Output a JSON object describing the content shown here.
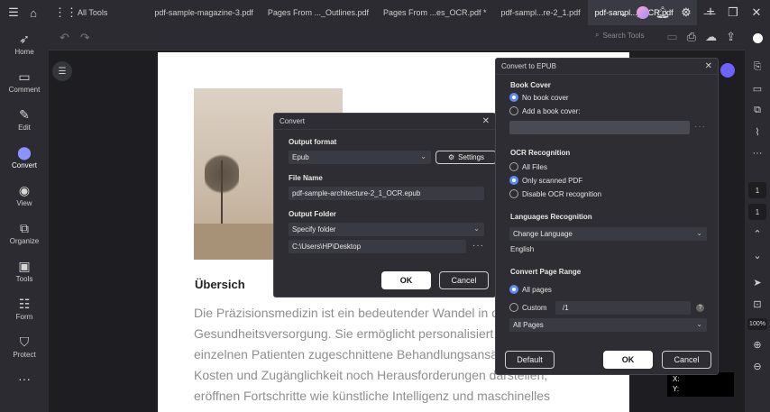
{
  "titlebar": {
    "all_tools": "All Tools",
    "tabs": [
      {
        "label": "pdf-sample-magazine-3.pdf"
      },
      {
        "label": "Pages  From ..._Outlines.pdf"
      },
      {
        "label": "Pages  From ...es_OCR.pdf *"
      },
      {
        "label": "pdf-sampl...re-2_1.pdf"
      },
      {
        "label": "pdf-sampl..._OCR.pdf"
      }
    ]
  },
  "sidebar": {
    "items": [
      {
        "label": "Home",
        "icon": "rocket-icon"
      },
      {
        "label": "Comment",
        "icon": "comment-icon"
      },
      {
        "label": "Edit",
        "icon": "edit-icon"
      },
      {
        "label": "Convert",
        "icon": "convert-icon"
      },
      {
        "label": "View",
        "icon": "eye-icon"
      },
      {
        "label": "Organize",
        "icon": "organize-icon"
      },
      {
        "label": "Tools",
        "icon": "toolbox-icon"
      },
      {
        "label": "Form",
        "icon": "form-icon"
      },
      {
        "label": "Protect",
        "icon": "shield-icon"
      }
    ]
  },
  "toolbar": {
    "search_label": "Search Tools"
  },
  "document": {
    "heading": "Übersich",
    "lines": [
      "Die Präzisionsmedizin ist ein bedeutender Wandel in d",
      "Gesundheitsversorgung. Sie ermöglicht personalisiert",
      "einzelnen Patienten zugeschnittene Behandlungsansä",
      "Kosten und Zugänglichkeit noch Herausforderungen darstellen,",
      "eröffnen Fortschritte wie künstliche Intelligenz und maschinelles"
    ]
  },
  "rightbar": {
    "page_current": "1",
    "page_total": "1",
    "zoom": "100%"
  },
  "coords": {
    "x_label": "X:",
    "y_label": "Y:"
  },
  "convert_dialog": {
    "title": "Convert",
    "output_format_label": "Output format",
    "output_format_value": "Epub",
    "settings_label": "Settings",
    "file_name_label": "File Name",
    "file_name_value": "pdf-sample-architecture-2_1_OCR.epub",
    "output_folder_label": "Output Folder",
    "output_folder_value": "Specify folder",
    "path_value": "C:\\Users\\HP\\Desktop",
    "ok_label": "OK",
    "cancel_label": "Cancel"
  },
  "epub_dialog": {
    "title": "Convert to EPUB",
    "book_cover_label": "Book Cover",
    "no_book_cover": "No book cover",
    "add_book_cover": "Add a book cover:",
    "ocr_label": "OCR Recognition",
    "ocr_all_files": "All Files",
    "ocr_only_scanned": "Only scanned PDF",
    "ocr_disable": "Disable OCR recognition",
    "lang_label": "Languages Recognition",
    "lang_select": "Change Language",
    "lang_value": "English",
    "range_label": "Convert Page Range",
    "range_all": "All pages",
    "range_custom": "Custom",
    "custom_value": "/1",
    "pages_select": "All Pages",
    "default_label": "Default",
    "ok_label": "OK",
    "cancel_label": "Cancel"
  }
}
